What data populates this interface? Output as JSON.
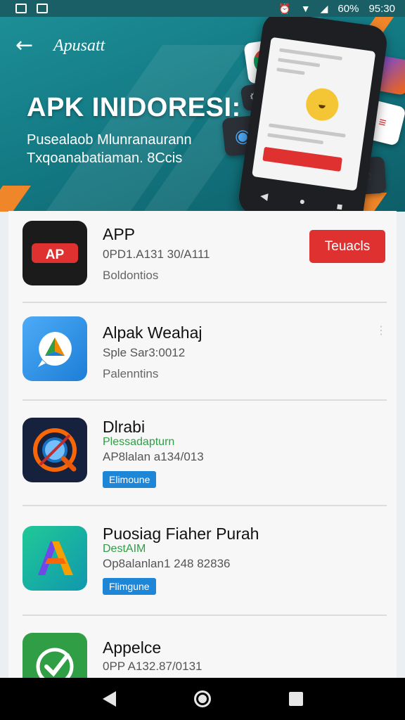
{
  "status_bar": {
    "battery": "60%",
    "time": "95:30"
  },
  "header": {
    "app_title": "Apusatt",
    "headline": "APK INIDORESI:",
    "subtitle_line1": "Pusealaob Mlunranaurann",
    "subtitle_line2": "Txqoanabatiaman. 8Ccis"
  },
  "apps": [
    {
      "name": "APP",
      "meta": "0PD1.A131 30/A111",
      "category": "Boldontios",
      "button": "Teuacls",
      "icon": "apk-red-logo-icon"
    },
    {
      "name": "Alpak Weahaj",
      "meta": "Sple Sar3:0012",
      "category": "Palenntins",
      "icon": "chat-bubble-icon"
    },
    {
      "name": "Dlrabi",
      "green_text": "Plessadapturn",
      "meta": "AP8lalan a134/013",
      "tag": "Elimoune",
      "icon": "magnifier-icon"
    },
    {
      "name": "Puosiag Fiaher Purah",
      "green_text": "DestAIM",
      "meta": "Op8alanlan1 248 82836",
      "tag": "Flimgune",
      "icon": "letter-a-icon"
    },
    {
      "name": "Appelce",
      "meta": "0PP A132.87/0131",
      "icon": "checkmark-icon"
    }
  ]
}
